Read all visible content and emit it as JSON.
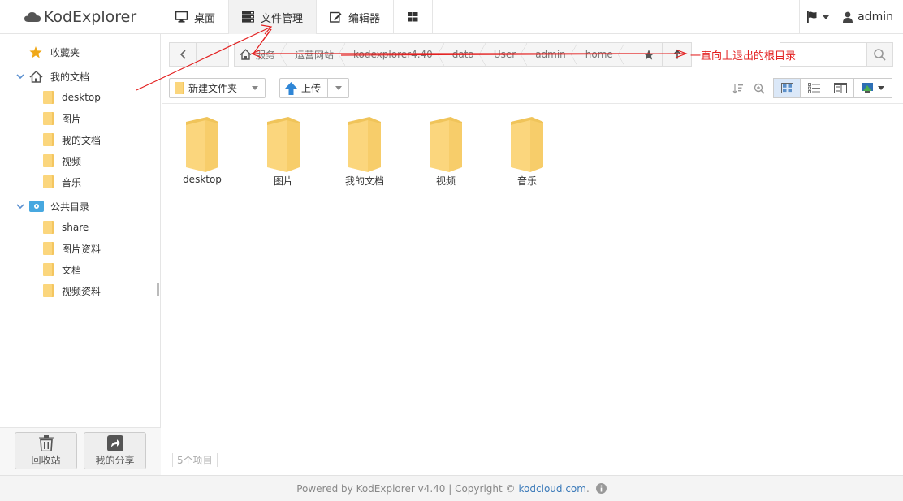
{
  "app": {
    "logo_text": "KodExplorer"
  },
  "nav": {
    "tabs": [
      {
        "label": "桌面",
        "icon": "monitor-icon"
      },
      {
        "label": "文件管理",
        "icon": "server-icon",
        "active": true
      },
      {
        "label": "编辑器",
        "icon": "edit-icon"
      },
      {
        "label": "",
        "icon": "grid-icon"
      }
    ]
  },
  "user": {
    "name": "admin",
    "flag_icon": "flag-icon"
  },
  "sidebar": {
    "favorites_label": "收藏夹",
    "my_docs_label": "我的文档",
    "my_docs_items": [
      "desktop",
      "图片",
      "我的文档",
      "视频",
      "音乐"
    ],
    "public_label": "公共目录",
    "public_items": [
      "share",
      "图片资料",
      "文档",
      "视频资料"
    ],
    "recycle_label": "回收站",
    "share_label": "我的分享"
  },
  "address": {
    "crumbs": [
      "服务",
      "运营网站",
      "kodexplorer4.40",
      "data",
      "User",
      "admin",
      "home"
    ],
    "search_value": ""
  },
  "annotation": {
    "text": "一直向上退出的根目录",
    "color": "#e32020"
  },
  "toolbar": {
    "new_folder_label": "新建文件夹",
    "upload_label": "上传"
  },
  "files": {
    "items": [
      "desktop",
      "图片",
      "我的文档",
      "视频",
      "音乐"
    ]
  },
  "status": {
    "count_text": "5个项目"
  },
  "footer": {
    "prefix": "Powered by KodExplorer v4.40 | Copyright ©",
    "link": "kodcloud.com",
    "suffix": "."
  }
}
